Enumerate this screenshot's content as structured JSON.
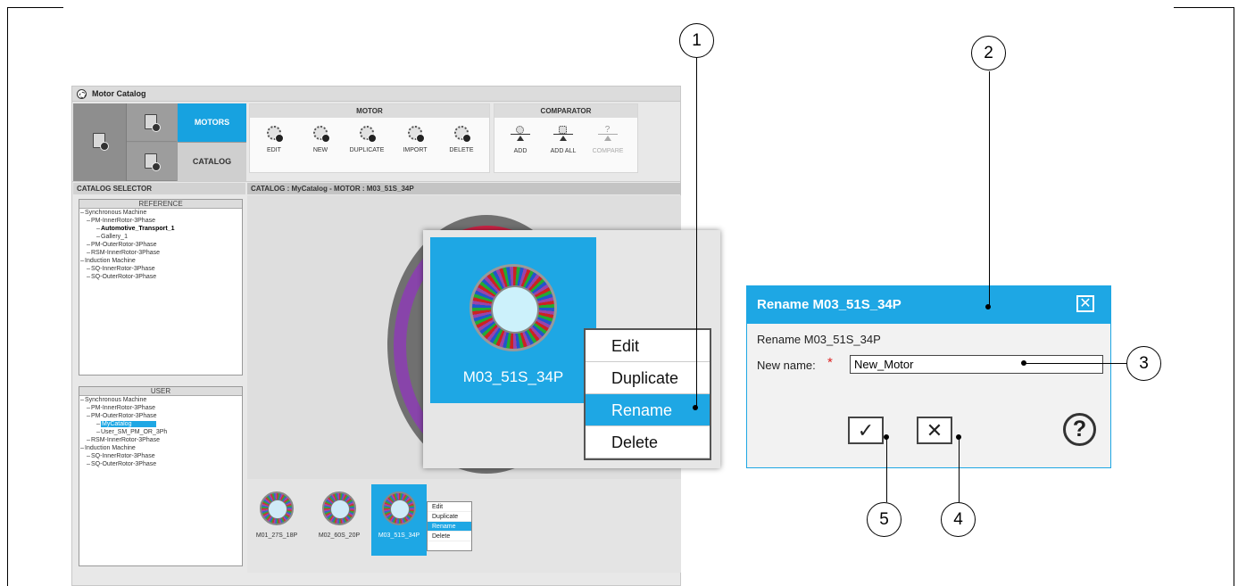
{
  "app": {
    "title": "Motor Catalog",
    "tabs": {
      "motors": "MOTORS",
      "catalog": "CATALOG"
    },
    "motor_group": {
      "title": "MOTOR",
      "tools": [
        "EDIT",
        "NEW",
        "DUPLICATE",
        "IMPORT",
        "DELETE"
      ]
    },
    "comparator_group": {
      "title": "COMPARATOR",
      "tools": [
        "ADD",
        "ADD ALL",
        "COMPARE"
      ],
      "compare_symbol": "?"
    },
    "selector_header": "CATALOG SELECTOR",
    "catalog_header": "CATALOG : MyCatalog  -  MOTOR : M03_51S_34P",
    "reference": {
      "title": "REFERENCE",
      "rows": [
        "Synchronous Machine",
        "PM-InnerRotor-3Phase",
        "Automotive_Transport_1",
        "Gallery_1",
        "PM-OuterRotor-3Phase",
        "RSM-InnerRotor-3Phase",
        "Induction Machine",
        "SQ-InnerRotor-3Phase",
        "SQ-OuterRotor-3Phase"
      ]
    },
    "user": {
      "title": "USER",
      "rows": [
        "Synchronous Machine",
        "PM-InnerRotor-3Phase",
        "PM-OuterRotor-3Phase",
        "MyCatalog",
        "User_SM_PM_OR_3Ph",
        "RSM-InnerRotor-3Phase",
        "Induction Machine",
        "SQ-InnerRotor-3Phase",
        "SQ-OuterRotor-3Phase"
      ]
    },
    "thumbnails": [
      "M01_27S_18P",
      "M02_60S_20P",
      "M03_51S_34P"
    ],
    "context_menu": [
      "Edit",
      "Duplicate",
      "Rename",
      "Delete"
    ]
  },
  "zoom": {
    "motor_label": "M03_51S_34P",
    "menu": [
      "Edit",
      "Duplicate",
      "Rename",
      "Delete"
    ]
  },
  "dialog": {
    "title": "Rename M03_51S_34P",
    "close_symbol": "✕",
    "subtitle": "Rename M03_51S_34P",
    "label": "New name:",
    "required_mark": "*",
    "input_value": "New_Motor",
    "ok_symbol": "✓",
    "cancel_symbol": "✕",
    "help_symbol": "?"
  },
  "callouts": [
    "1",
    "2",
    "3",
    "4",
    "5"
  ],
  "colors": {
    "accent": "#1ea7e4",
    "toolbar_dark": "#9a9a9a"
  }
}
